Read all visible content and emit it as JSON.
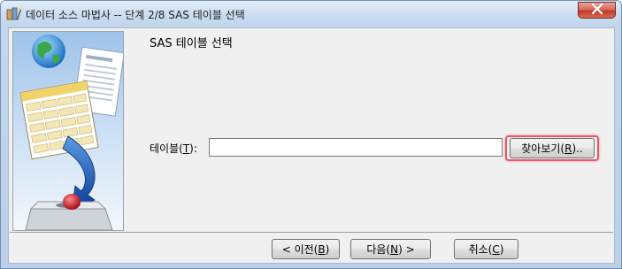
{
  "window": {
    "title": "데이터 소스 마법사 -- 단계 2/8 SAS 테이블 선택",
    "icons": {
      "app": "wizard-app-icon",
      "close": "close-icon"
    }
  },
  "sidebar": {
    "image": "wizard-illustration"
  },
  "main": {
    "heading": "SAS 테이블 선택",
    "table_field": {
      "label_prefix": "테이블(",
      "label_mnemonic": "T",
      "label_suffix": "):",
      "value": "",
      "placeholder": ""
    },
    "browse_button": {
      "prefix": "찾아보기(",
      "mnemonic": "R",
      "suffix": ").."
    }
  },
  "footer": {
    "prev_button": {
      "prefix": "< 이전(",
      "mnemonic": "B",
      "suffix": ")"
    },
    "next_button": {
      "prefix": "다음(",
      "mnemonic": "N",
      "suffix": ") >"
    },
    "cancel_button": {
      "prefix": "취소(",
      "mnemonic": "C",
      "suffix": ")"
    }
  },
  "colors": {
    "focus_ring": "#e05a6a",
    "close_button": "#c0392b"
  }
}
